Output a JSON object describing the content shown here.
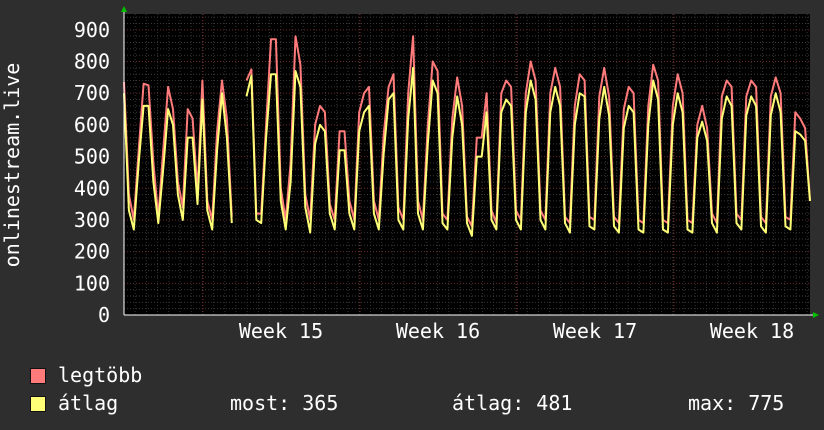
{
  "chart_data": {
    "type": "line",
    "title": "",
    "xlabel": "",
    "ylabel": "onlinestream.live",
    "ylim": [
      0,
      950
    ],
    "yticks": [
      0,
      100,
      200,
      300,
      400,
      500,
      600,
      700,
      800,
      900
    ],
    "x_tick_labels": [
      "Week  15",
      "Week  16",
      "Week  17",
      "Week  18"
    ],
    "grid": true,
    "legend_placement": "bottom-left",
    "series": [
      {
        "name": "legtöbb",
        "color": "#ff7b7b",
        "values": [
          735,
          380,
          300,
          520,
          730,
          725,
          480,
          310,
          520,
          720,
          650,
          420,
          340,
          650,
          620,
          390,
          740,
          360,
          300,
          580,
          740,
          620,
          310,
          null,
          null,
          740,
          775,
          320,
          320,
          600,
          870,
          870,
          400,
          300,
          480,
          880,
          790,
          380,
          300,
          600,
          660,
          640,
          350,
          300,
          580,
          580,
          360,
          300,
          640,
          700,
          720,
          360,
          300,
          570,
          720,
          760,
          340,
          300,
          700,
          880,
          360,
          300,
          600,
          800,
          770,
          320,
          300,
          620,
          750,
          660,
          310,
          280,
          560,
          560,
          700,
          330,
          290,
          700,
          740,
          720,
          330,
          300,
          700,
          800,
          740,
          330,
          300,
          700,
          780,
          720,
          310,
          290,
          660,
          760,
          740,
          310,
          300,
          690,
          780,
          690,
          310,
          290,
          650,
          720,
          700,
          300,
          290,
          660,
          790,
          740,
          300,
          290,
          660,
          760,
          700,
          300,
          290,
          600,
          660,
          590,
          320,
          290,
          690,
          740,
          720,
          320,
          300,
          690,
          740,
          720,
          310,
          290,
          690,
          750,
          700,
          310,
          300,
          640,
          620,
          590,
          360
        ]
      },
      {
        "name": "átlag",
        "color": "#ffff77",
        "values": [
          700,
          330,
          270,
          480,
          660,
          660,
          420,
          290,
          460,
          650,
          600,
          380,
          300,
          560,
          560,
          350,
          680,
          330,
          270,
          520,
          700,
          560,
          290,
          null,
          null,
          690,
          755,
          300,
          290,
          560,
          760,
          760,
          360,
          270,
          420,
          770,
          720,
          340,
          260,
          540,
          600,
          580,
          320,
          270,
          520,
          520,
          320,
          270,
          580,
          640,
          660,
          320,
          270,
          510,
          680,
          700,
          300,
          270,
          620,
          780,
          320,
          270,
          540,
          740,
          700,
          290,
          270,
          560,
          690,
          600,
          290,
          250,
          500,
          500,
          640,
          300,
          270,
          640,
          680,
          660,
          300,
          270,
          640,
          740,
          680,
          300,
          270,
          640,
          720,
          660,
          290,
          260,
          600,
          700,
          690,
          280,
          270,
          620,
          720,
          630,
          280,
          260,
          590,
          660,
          640,
          270,
          260,
          600,
          740,
          680,
          270,
          260,
          600,
          700,
          640,
          270,
          260,
          560,
          610,
          550,
          290,
          260,
          620,
          690,
          660,
          290,
          270,
          630,
          690,
          660,
          280,
          260,
          630,
          700,
          640,
          280,
          270,
          580,
          570,
          550,
          360
        ]
      }
    ]
  },
  "legend": {
    "items": [
      {
        "label": "legtöbb",
        "color": "#ff7b7b"
      },
      {
        "label": "átlag",
        "color": "#ffff77"
      }
    ],
    "stats": {
      "most": "most: 365",
      "atlag": "átlag: 481",
      "max": "max: 775"
    }
  }
}
